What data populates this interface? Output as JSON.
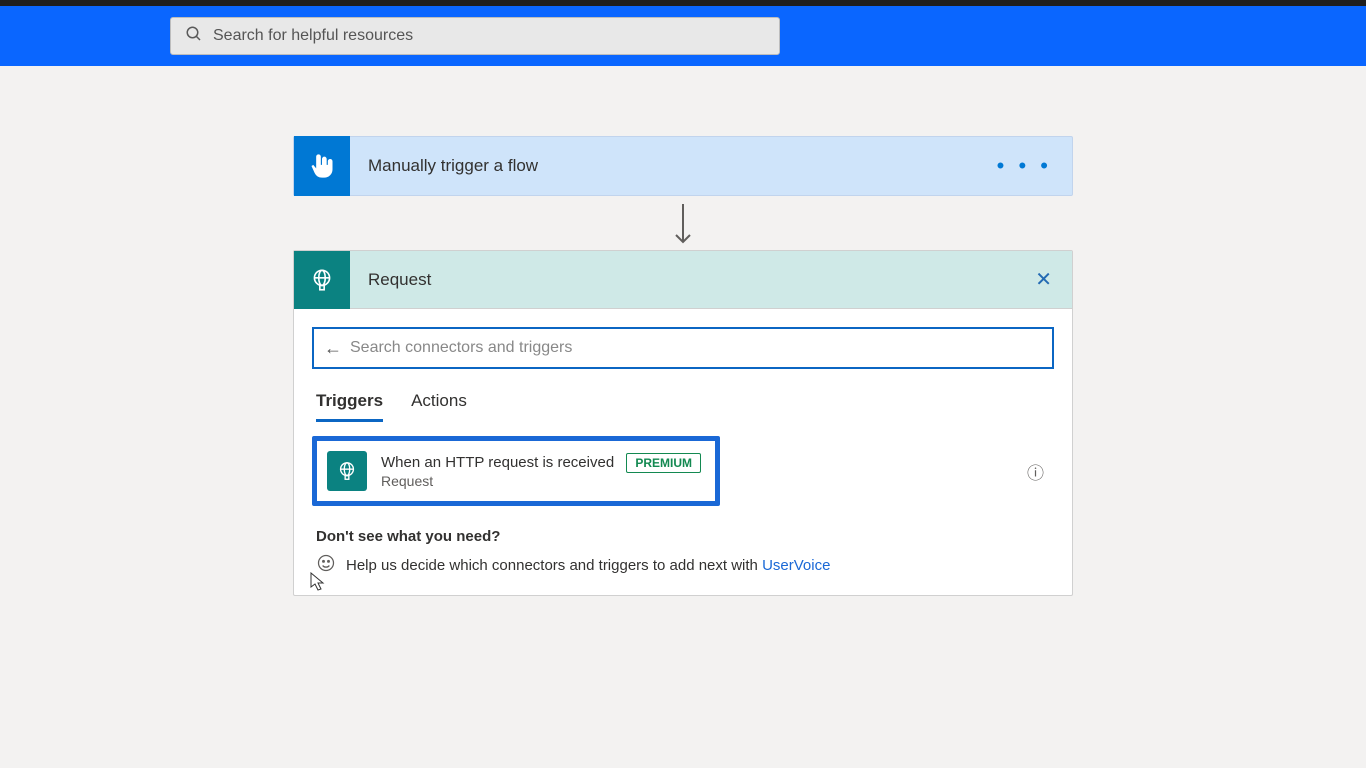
{
  "topbar": {
    "search_placeholder": "Search for helpful resources"
  },
  "trigger": {
    "title": "Manually trigger a flow",
    "menu_label": "• • •"
  },
  "request": {
    "header_title": "Request",
    "close_label": "✕",
    "search_placeholder": "Search connectors and triggers",
    "back_label": "←",
    "tabs": {
      "triggers": "Triggers",
      "actions": "Actions"
    },
    "item": {
      "title": "When an HTTP request is received",
      "subtitle": "Request",
      "badge": "PREMIUM",
      "info_label": "ⓘ"
    },
    "need": {
      "title": "Don't see what you need?",
      "text": "Help us decide which connectors and triggers to add next with ",
      "link": "UserVoice"
    }
  }
}
